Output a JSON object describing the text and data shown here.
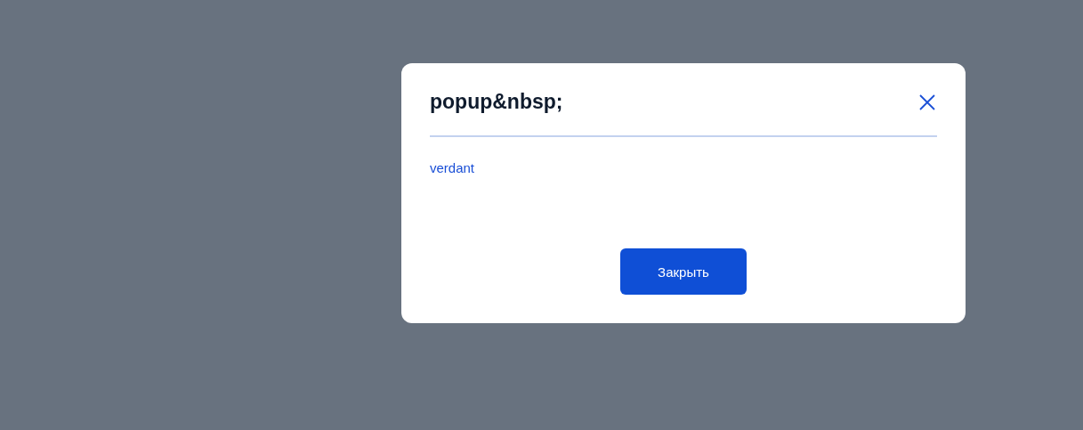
{
  "dialog": {
    "title": "popup&nbsp;",
    "link": "verdant",
    "buttons": [
      {
        "label": "Закрыть",
        "kind": "primary"
      }
    ]
  }
}
